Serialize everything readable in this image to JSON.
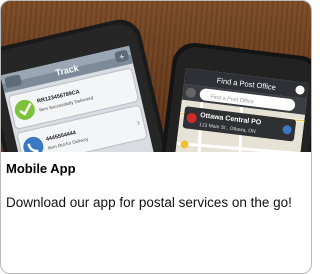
{
  "promo": {
    "title": "Mobile App",
    "description": "Download our app for postal services on the go!"
  },
  "phone_left": {
    "header": "Track",
    "back_label": "←",
    "add_label": "+",
    "items": [
      {
        "icon": "checkmark-icon",
        "code": "RR123456789CA",
        "status": "Item Successfully Delivered"
      },
      {
        "icon": "phone-icon",
        "code": "4445554444",
        "status": "Item Out for Delivery"
      }
    ]
  },
  "phone_right": {
    "header": "Find a Post Office",
    "search_placeholder": "Find a Post Office",
    "location_title": "Ottawa Central PO",
    "location_address": "123 Main St., Ottawa, ON"
  },
  "colors": {
    "wood": "#6a3c1d",
    "phone_body": "#1b1b1b",
    "checkmark_green": "#7cc23b",
    "phone_blue": "#3a78c4"
  }
}
